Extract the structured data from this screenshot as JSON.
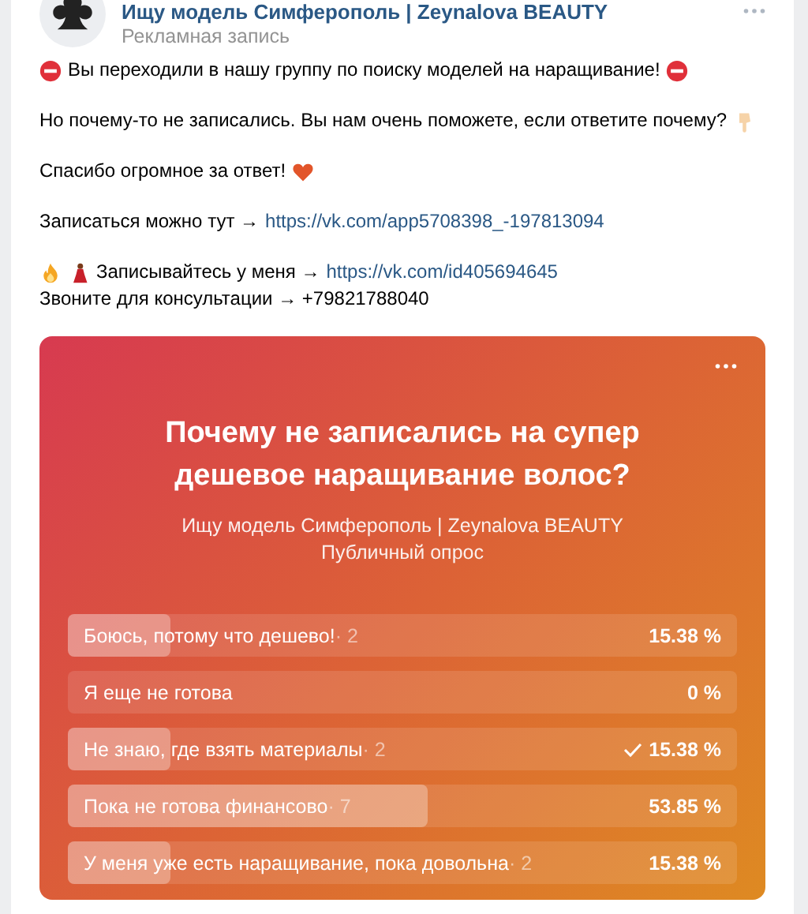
{
  "post": {
    "author": "Ищу модель Симферополь | Zeynalova BEAUTY",
    "label": "Рекламная запись",
    "paragraphs": [
      {
        "lines": [
          {
            "parts": [
              {
                "kind": "no-entry"
              },
              {
                "kind": "text",
                "text": "Вы переходили в нашу группу по поиску моделей на наращивание!"
              },
              {
                "kind": "no-entry"
              }
            ]
          }
        ]
      },
      {
        "lines": [
          {
            "parts": [
              {
                "kind": "text",
                "text": "Но почему-то не записались. Вы нам очень поможете, если ответите почему?"
              },
              {
                "kind": "hand"
              }
            ]
          }
        ]
      },
      {
        "lines": [
          {
            "parts": [
              {
                "kind": "text",
                "text": "Спасибо огромное за ответ!"
              },
              {
                "kind": "heart"
              }
            ]
          }
        ]
      },
      {
        "lines": [
          {
            "parts": [
              {
                "kind": "text",
                "text": "Записаться можно тут →"
              },
              {
                "kind": "link",
                "text": "https://vk.com/app5708398_-197813094"
              }
            ]
          }
        ]
      },
      {
        "lines": [
          {
            "parts": [
              {
                "kind": "fire"
              },
              {
                "kind": "dancer"
              },
              {
                "kind": "text",
                "text": "Записывайтесь у меня →"
              },
              {
                "kind": "link",
                "text": "https://vk.com/id405694645"
              }
            ]
          },
          {
            "parts": [
              {
                "kind": "text",
                "text": "Звоните для консультации → +79821788040"
              }
            ]
          }
        ]
      }
    ]
  },
  "poll": {
    "question": "Почему не записались на супер дешевое наращивание волос?",
    "owner": "Ищу модель Симферополь | Zeynalova BEAUTY",
    "type": "Публичный опрос",
    "options": [
      {
        "text": "Боюсь, потому что дешево!",
        "votes": "· 2",
        "percent": "15.38 %",
        "level": 0.1538,
        "selected": false
      },
      {
        "text": "Я еще не готова",
        "percent": "0 %",
        "selected": false
      },
      {
        "text": "Не знаю, где взять материалы",
        "votes": "· 2",
        "percent": "15.38 %",
        "level": 0.1538,
        "selected": true
      },
      {
        "text": "Пока не готова финансово",
        "votes": "· 7",
        "percent": "53.85 %",
        "level": 0.5385,
        "selected": false
      },
      {
        "text": "У меня уже есть наращивание, пока довольна",
        "votes": "· 2",
        "percent": "15.38 %",
        "level": 0.1538,
        "selected": false
      }
    ]
  }
}
